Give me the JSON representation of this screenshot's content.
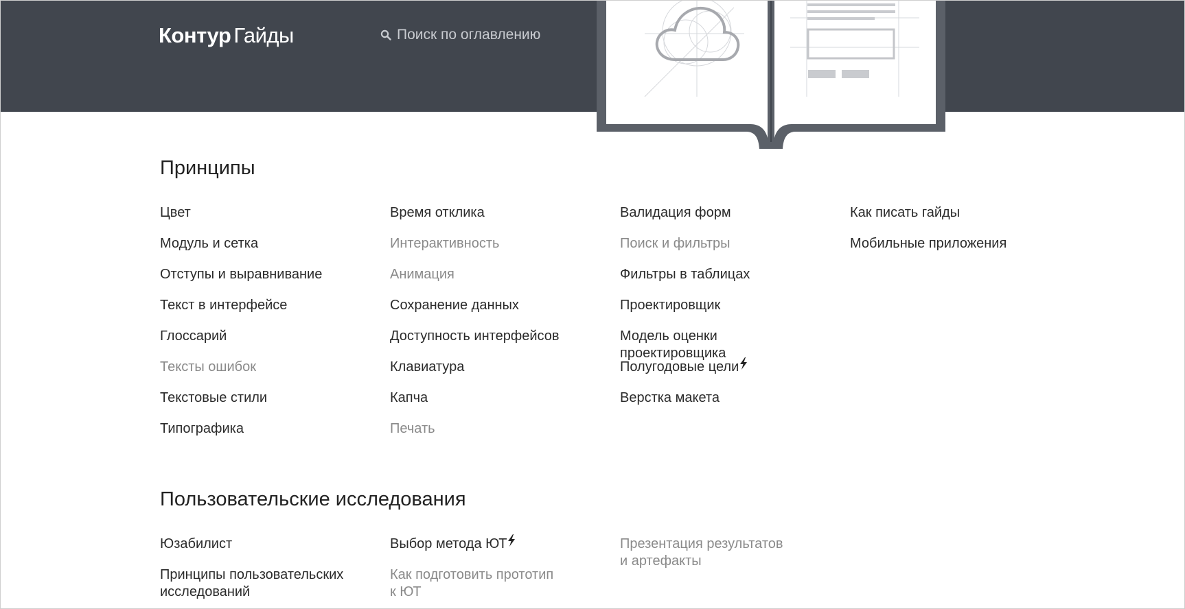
{
  "header": {
    "logo_bold": "Контур",
    "logo_light": "Гайды",
    "search_placeholder": "Поиск по оглавлению"
  },
  "sections": [
    {
      "title": "Принципы",
      "columns": [
        [
          {
            "label": "Цвет",
            "muted": false
          },
          {
            "label": "Модуль и сетка",
            "muted": false
          },
          {
            "label": "Отступы и выравнивание",
            "muted": false
          },
          {
            "label": "Текст в интерфейсе",
            "muted": false
          },
          {
            "label": "Глоссарий",
            "muted": false
          },
          {
            "label": "Тексты ошибок",
            "muted": true
          },
          {
            "label": "Текстовые стили",
            "muted": false
          },
          {
            "label": "Типографика",
            "muted": false
          }
        ],
        [
          {
            "label": "Время отклика",
            "muted": false
          },
          {
            "label": "Интерактивность",
            "muted": true
          },
          {
            "label": "Анимация",
            "muted": true
          },
          {
            "label": "Сохранение данных",
            "muted": false
          },
          {
            "label": "Доступность интерфейсов",
            "muted": false
          },
          {
            "label": "Клавиатура",
            "muted": false
          },
          {
            "label": "Капча",
            "muted": false
          },
          {
            "label": "Печать",
            "muted": true
          }
        ],
        [
          {
            "label": "Валидация форм",
            "muted": false
          },
          {
            "label": "Поиск и фильтры",
            "muted": true
          },
          {
            "label": "Фильтры в таблицах",
            "muted": false
          },
          {
            "label": "Проектировщик",
            "muted": false
          },
          {
            "label": "Модель оценки проектировщика",
            "muted": false,
            "lines": [
              "Модель оценки",
              "проектировщика"
            ]
          },
          {
            "label": "Полугодовые цели",
            "muted": false,
            "new": true
          },
          {
            "label": "Верстка макета",
            "muted": false
          }
        ],
        [
          {
            "label": "Как писать гайды",
            "muted": false
          },
          {
            "label": "Мобильные приложения",
            "muted": false
          }
        ]
      ]
    },
    {
      "title": "Пользовательские исследования",
      "columns": [
        [
          {
            "label": "Юзабилист",
            "muted": false
          },
          {
            "label": "Принципы пользовательских исследований",
            "muted": false,
            "lines": [
              "Принципы пользовательских",
              "исследований"
            ]
          }
        ],
        [
          {
            "label": "Выбор метода ЮТ",
            "muted": false,
            "new": true
          },
          {
            "label": "Как подготовить прототип к ЮТ",
            "muted": true,
            "lines": [
              "Как подготовить прототип",
              "к ЮТ"
            ]
          }
        ],
        [
          {
            "label": "Презентация результатов и артефакты",
            "muted": true,
            "lines": [
              "Презентация результатов",
              "и артефакты"
            ]
          }
        ]
      ]
    }
  ],
  "colors": {
    "header_bg": "#41464e",
    "text": "#2b2b2b",
    "muted": "#8a8a8a",
    "book_frame": "#5b6068"
  },
  "icons": {
    "search": "search-icon",
    "new": "lightning-icon",
    "hero": "book-illustration"
  }
}
